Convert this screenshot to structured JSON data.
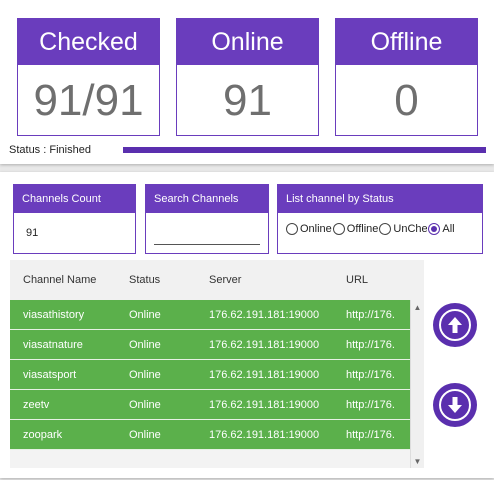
{
  "stats": {
    "checked": {
      "label": "Checked",
      "value": "91/91"
    },
    "online": {
      "label": "Online",
      "value": "91"
    },
    "offline": {
      "label": "Offline",
      "value": "0"
    }
  },
  "status": {
    "text": "Status : Finished",
    "progress_percent": 100
  },
  "controls": {
    "count": {
      "label": "Channels Count",
      "value": "91"
    },
    "search": {
      "label": "Search Channels",
      "value": "",
      "placeholder": ""
    },
    "filter": {
      "label": "List channel by Status",
      "options": [
        "Online",
        "Offline",
        "UnChe",
        "All"
      ],
      "selected": "All"
    }
  },
  "table": {
    "columns": [
      "Channel Name",
      "Status",
      "Server",
      "URL"
    ],
    "rows": [
      [
        "viasathistory",
        "Online",
        "176.62.191.181:19000",
        "http://176."
      ],
      [
        "viasatnature",
        "Online",
        "176.62.191.181:19000",
        "http://176."
      ],
      [
        "viasatsport",
        "Online",
        "176.62.191.181:19000",
        "http://176."
      ],
      [
        "zeetv",
        "Online",
        "176.62.191.181:19000",
        "http://176."
      ],
      [
        "zoopark",
        "Online",
        "176.62.191.181:19000",
        "http://176."
      ]
    ]
  },
  "icons": {
    "scroll_up": "arrow-up-circle-icon",
    "scroll_down": "arrow-down-circle-icon"
  },
  "colors": {
    "accent": "#6a3dbd",
    "row_online": "#5bb04b"
  }
}
